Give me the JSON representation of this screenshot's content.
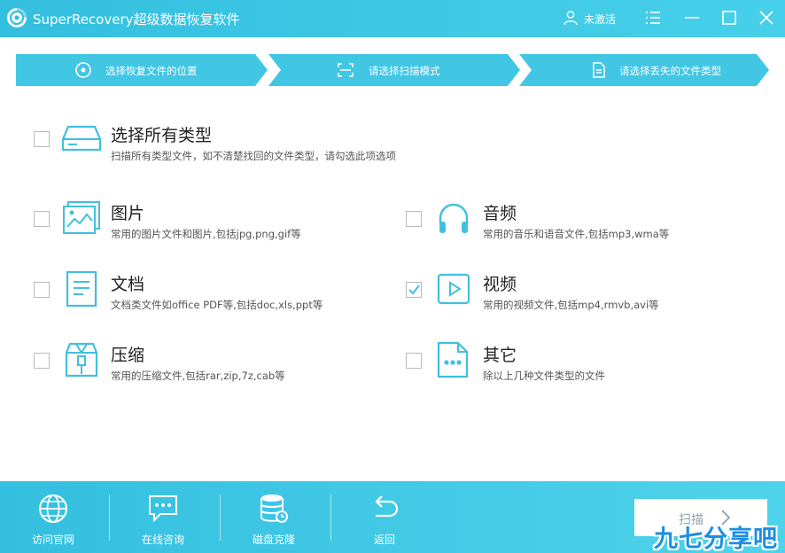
{
  "app": {
    "title": "SuperRecovery超级数据恢复软件",
    "user_status": "未激活"
  },
  "colors": {
    "accent": "#34bfe0",
    "accent_light": "#47d0ea",
    "icon": "#41bfdf",
    "check": "#41bfdf"
  },
  "steps": [
    {
      "label": "选择恢复文件的位置",
      "icon": "location-disc-icon"
    },
    {
      "label": "请选择扫描模式",
      "icon": "scan-frame-icon"
    },
    {
      "label": "请选择丢失的文件类型",
      "icon": "document-icon"
    }
  ],
  "options": {
    "all": {
      "title": "选择所有类型",
      "desc": "扫描所有类型文件，如不清楚找回的文件类型，请勾选此项选项",
      "checked": false,
      "icon": "drive-icon"
    },
    "image": {
      "title": "图片",
      "desc": "常用的图片文件和图片,包括jpg,png,gif等",
      "checked": false,
      "icon": "picture-icon"
    },
    "audio": {
      "title": "音频",
      "desc": "常用的音乐和语音文件,包括mp3,wma等",
      "checked": false,
      "icon": "headphones-icon"
    },
    "document": {
      "title": "文档",
      "desc": "文档类文件如office PDF等,包括doc,xls,ppt等",
      "checked": false,
      "icon": "text-document-icon"
    },
    "video": {
      "title": "视频",
      "desc": "常用的视频文件,包括mp4,rmvb,avi等",
      "checked": true,
      "icon": "play-icon"
    },
    "archive": {
      "title": "压缩",
      "desc": "常用的压缩文件,包括rar,zip,7z,cab等",
      "checked": false,
      "icon": "archive-icon"
    },
    "other": {
      "title": "其它",
      "desc": "除以上几种文件类型的文件",
      "checked": false,
      "icon": "more-file-icon"
    }
  },
  "bottom": {
    "website": "访问官网",
    "consult": "在线咨询",
    "clone": "磁盘克隆",
    "back": "返回",
    "scan": "扫描"
  },
  "watermark": "九七分享吧"
}
